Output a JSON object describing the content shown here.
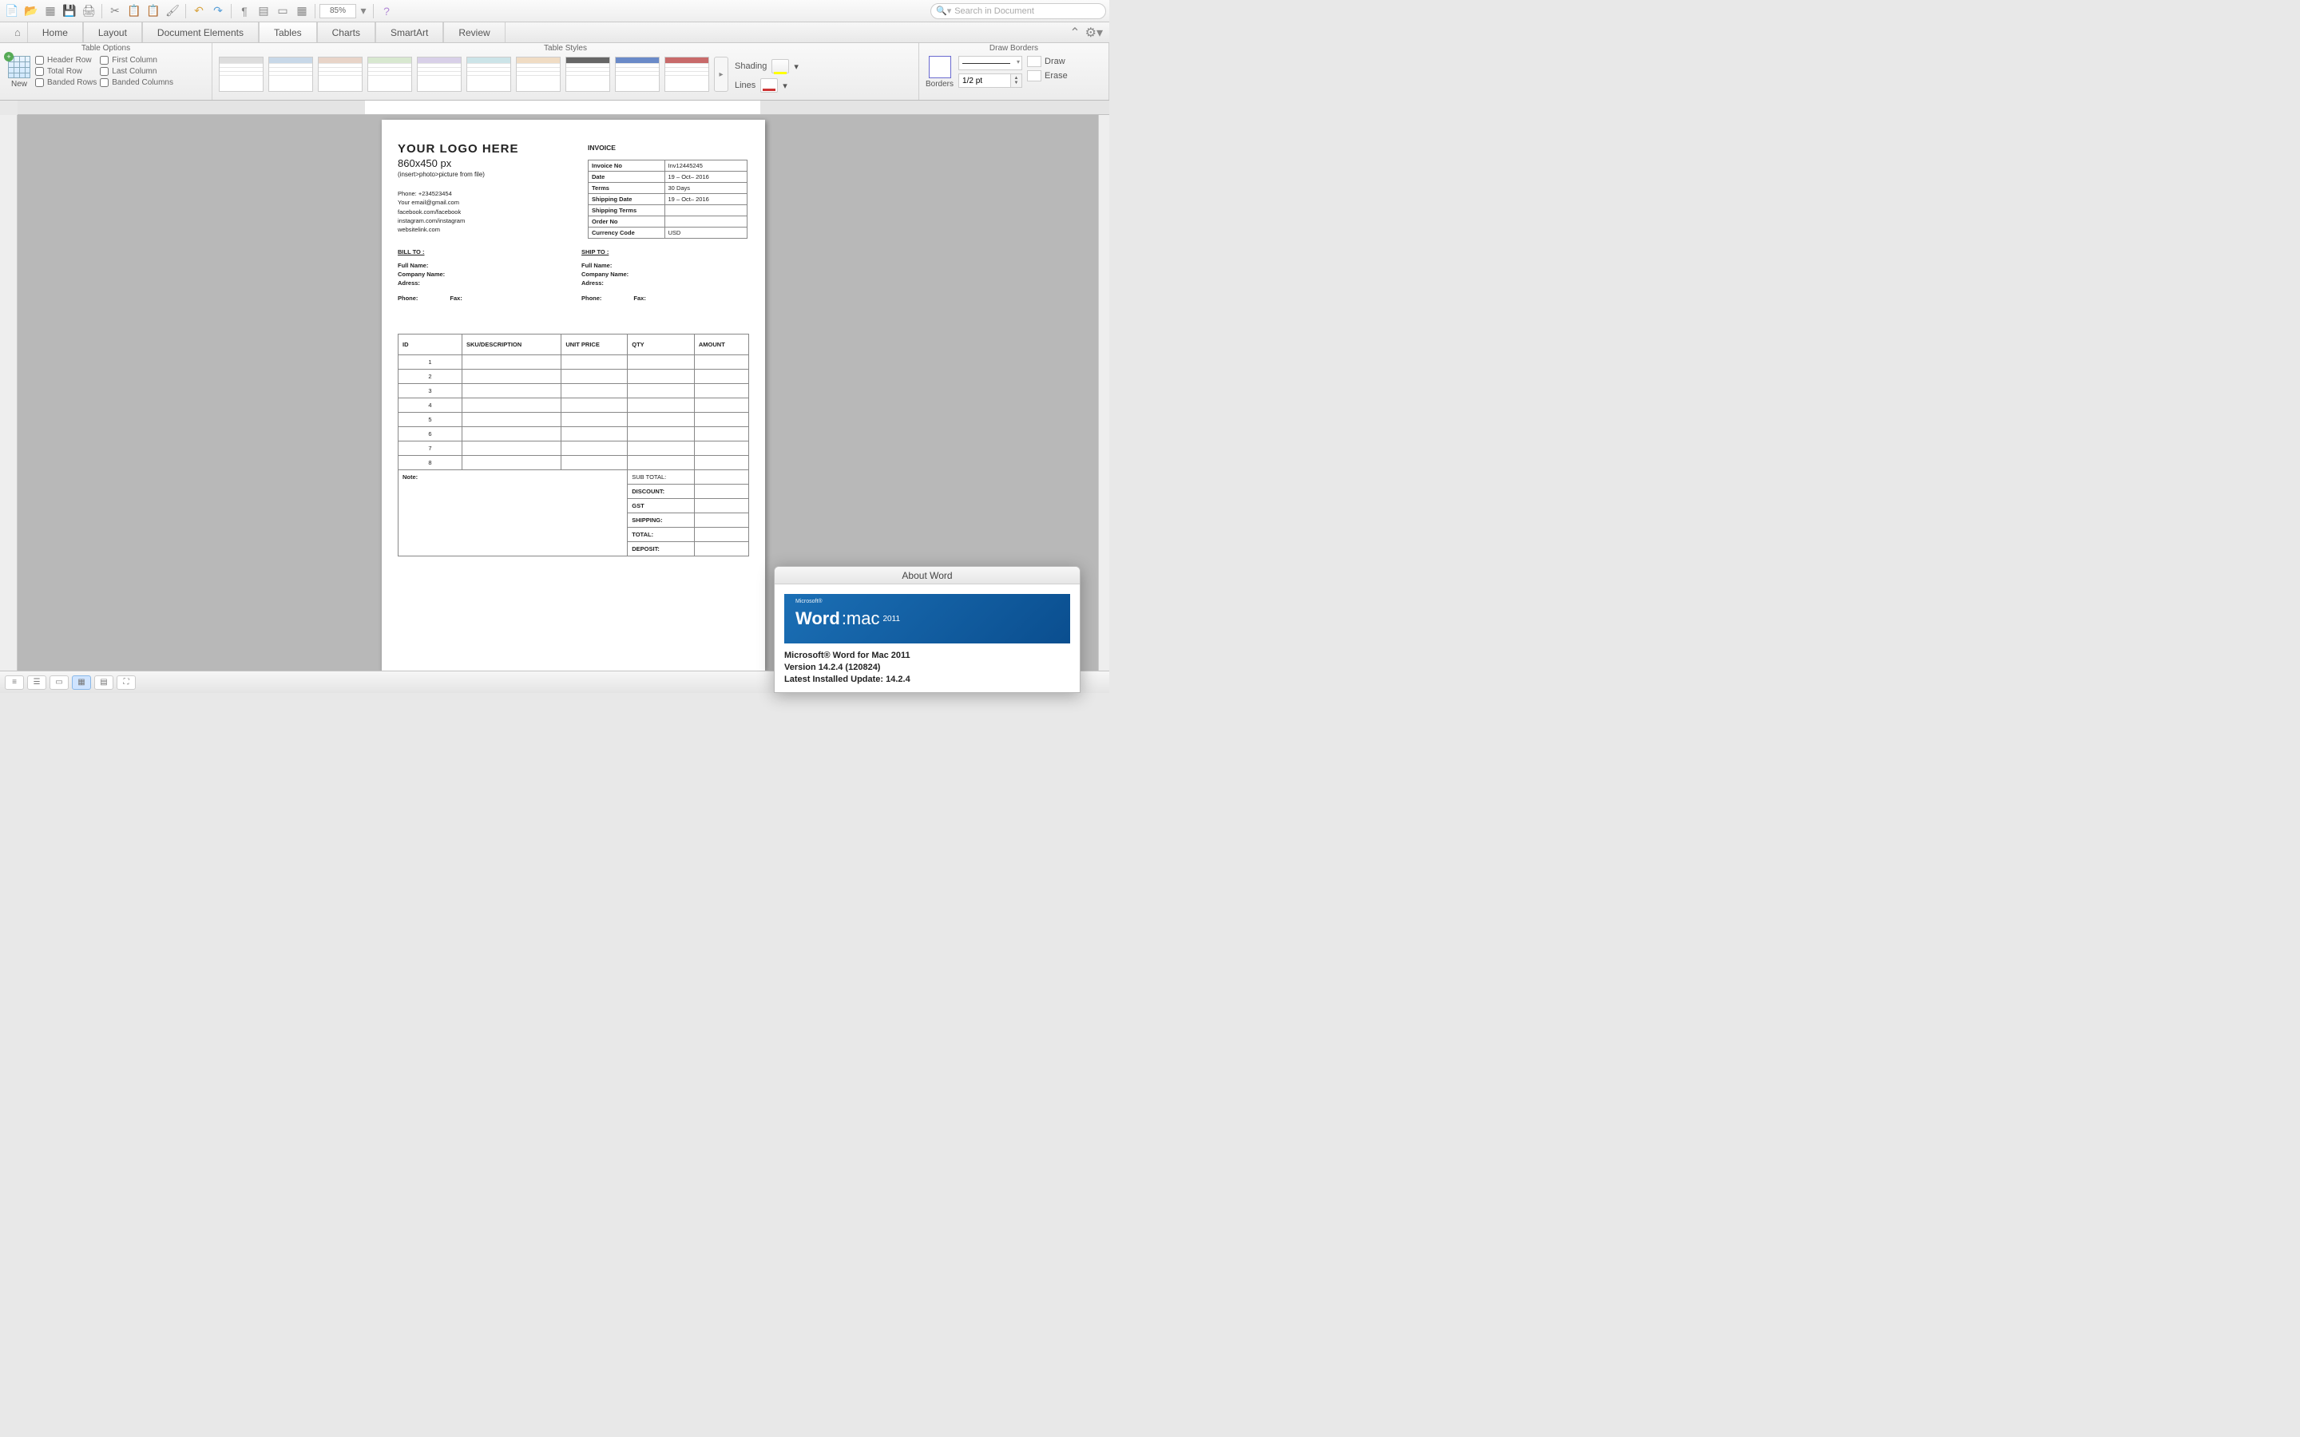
{
  "toolbar": {
    "zoom": "85%",
    "search_placeholder": "Search in Document"
  },
  "ribbon": {
    "tabs": [
      "Home",
      "Layout",
      "Document Elements",
      "Tables",
      "Charts",
      "SmartArt",
      "Review"
    ],
    "active_tab": "Tables",
    "groups": {
      "options_title": "Table Options",
      "styles_title": "Table Styles",
      "draw_title": "Draw Borders",
      "new_label": "New",
      "checks_col1": [
        "Header Row",
        "Total Row",
        "Banded Rows"
      ],
      "checks_col2": [
        "First Column",
        "Last Column",
        "Banded Columns"
      ],
      "shading": "Shading",
      "lines": "Lines",
      "borders": "Borders",
      "line_weight": "1/2 pt",
      "draw": "Draw",
      "erase": "Erase"
    }
  },
  "doc": {
    "logo_title": "YOUR  LOGO HERE",
    "logo_size": "860x450 px",
    "logo_hint": "(insert>photo>picture from file)",
    "contact": {
      "phone": "Phone: +234523454",
      "email": "Your email@gmail.com",
      "facebook": "facebook.com/facebook",
      "instagram": "instagram.com/instagram",
      "website": "websitelink.com"
    },
    "invoice_label": "INVOICE",
    "meta": [
      {
        "k": "Invoice No",
        "v": "Inv12445245"
      },
      {
        "k": "Date",
        "v": "19 – Oct– 2016"
      },
      {
        "k": "Terms",
        "v": "30 Days"
      },
      {
        "k": "Shipping Date",
        "v": "19 – Oct– 2016"
      },
      {
        "k": "Shipping Terms",
        "v": ""
      },
      {
        "k": "Order No",
        "v": ""
      },
      {
        "k": "Currency Code",
        "v": "USD"
      }
    ],
    "bill_to": "BILL TO :",
    "ship_to": "SHIP TO :",
    "fields": {
      "name": "Full Name:",
      "company": "Company Name:",
      "address": "Adress:",
      "phone": "Phone:",
      "fax": "Fax:"
    },
    "items_header": [
      "ID",
      "SKU/DESCRIPTION",
      "UNIT PRICE",
      "QTY",
      "AMOUNT"
    ],
    "item_rows": [
      "1",
      "2",
      "3",
      "4",
      "5",
      "6",
      "7",
      "8"
    ],
    "note_label": "Note:",
    "totals": [
      "SUB TOTAL:",
      "DISCOUNT:",
      "GST",
      "SHIPPING:",
      "TOTAL:",
      "DEPOSIT:"
    ]
  },
  "about": {
    "title": "About Word",
    "banner_word": "Word",
    "banner_mac": ":mac",
    "banner_year": "2011",
    "banner_ms": "Microsoft®",
    "line1": "Microsoft® Word for Mac 2011",
    "line2": "Version 14.2.4 (120824)",
    "line3": "Latest Installed Update: 14.2.4"
  }
}
